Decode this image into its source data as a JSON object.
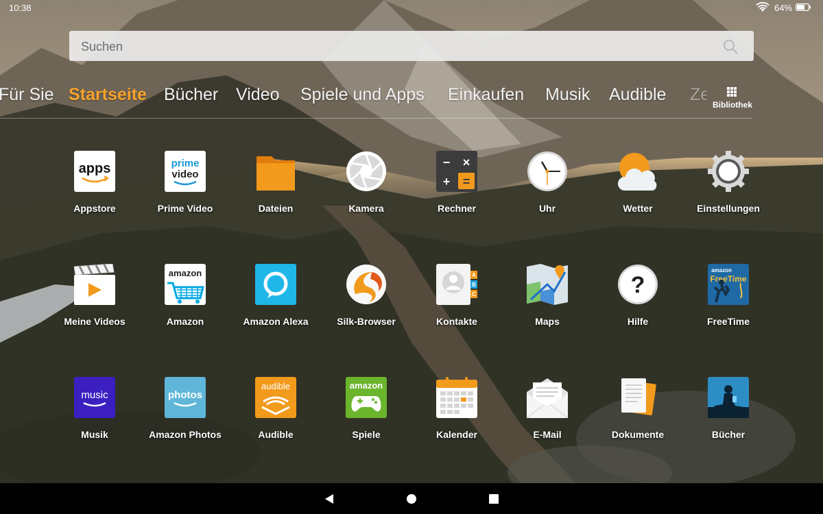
{
  "status_bar": {
    "time": "10:38",
    "battery": "64%"
  },
  "search": {
    "placeholder": "Suchen"
  },
  "tabs": [
    {
      "label": "Für Sie",
      "active": false
    },
    {
      "label": "Startseite",
      "active": true
    },
    {
      "label": "Bücher",
      "active": false
    },
    {
      "label": "Video",
      "active": false
    },
    {
      "label": "Spiele und Apps",
      "active": false
    },
    {
      "label": "Einkaufen",
      "active": false
    },
    {
      "label": "Musik",
      "active": false
    },
    {
      "label": "Audible",
      "active": false
    },
    {
      "label": "Ze",
      "active": false
    }
  ],
  "library": {
    "label": "Bibliothek"
  },
  "apps": [
    {
      "label": "Appstore",
      "icon": "appstore-icon"
    },
    {
      "label": "Prime Video",
      "icon": "prime-video-icon"
    },
    {
      "label": "Dateien",
      "icon": "folder-icon"
    },
    {
      "label": "Kamera",
      "icon": "camera-icon"
    },
    {
      "label": "Rechner",
      "icon": "calculator-icon"
    },
    {
      "label": "Uhr",
      "icon": "clock-icon"
    },
    {
      "label": "Wetter",
      "icon": "weather-icon"
    },
    {
      "label": "Einstellungen",
      "icon": "gear-icon"
    },
    {
      "label": "Meine Videos",
      "icon": "video-clapper-icon"
    },
    {
      "label": "Amazon",
      "icon": "amazon-cart-icon"
    },
    {
      "label": "Amazon Alexa",
      "icon": "alexa-icon"
    },
    {
      "label": "Silk-Browser",
      "icon": "silk-browser-icon"
    },
    {
      "label": "Kontakte",
      "icon": "contacts-icon"
    },
    {
      "label": "Maps",
      "icon": "maps-icon"
    },
    {
      "label": "Hilfe",
      "icon": "help-icon"
    },
    {
      "label": "FreeTime",
      "icon": "freetime-icon"
    },
    {
      "label": "Musik",
      "icon": "amazon-music-icon"
    },
    {
      "label": "Amazon Photos",
      "icon": "amazon-photos-icon"
    },
    {
      "label": "Audible",
      "icon": "audible-icon"
    },
    {
      "label": "Spiele",
      "icon": "amazon-games-icon"
    },
    {
      "label": "Kalender",
      "icon": "calendar-icon"
    },
    {
      "label": "E-Mail",
      "icon": "email-icon"
    },
    {
      "label": "Dokumente",
      "icon": "documents-icon"
    },
    {
      "label": "Bücher",
      "icon": "kindle-books-icon"
    }
  ],
  "icon_text": {
    "appstore": "apps",
    "prime_line1": "prime",
    "prime_line2": "video",
    "amazon": "amazon",
    "freetime_brand": "amazon",
    "freetime_name": "FreeTime",
    "music": "music",
    "photos": "photos",
    "audible": "audible",
    "games": "amazon",
    "calc_ops": [
      "−",
      "×",
      "+",
      "="
    ],
    "contacts_letters": [
      "A",
      "B",
      "C"
    ],
    "help": "?"
  },
  "colors": {
    "accent": "#f7a22c",
    "navbar": "#000000"
  }
}
